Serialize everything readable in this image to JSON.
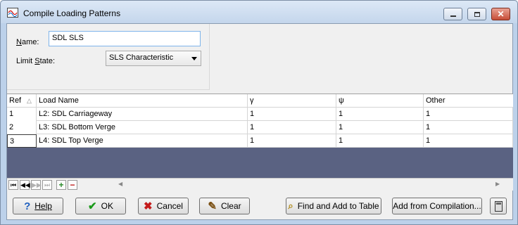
{
  "window": {
    "title": "Compile Loading Patterns",
    "icon": "chart-icon",
    "controls": [
      "minimize-icon",
      "maximize-icon",
      "close-icon"
    ]
  },
  "form": {
    "name_label": "Name:",
    "name_value": "SDL SLS",
    "limit_state_label": "Limit State:",
    "limit_state_value": "SLS Characteristic"
  },
  "grid": {
    "columns": [
      "Ref",
      "Load Name",
      "γ",
      "ψ",
      "Other"
    ],
    "rows": [
      [
        "1",
        "L2: SDL Carriageway",
        "1",
        "1",
        "1"
      ],
      [
        "2",
        "L3: SDL Bottom Verge",
        "1",
        "1",
        "1"
      ],
      [
        "3",
        "L4: SDL Top Verge",
        "1",
        "1",
        "1"
      ]
    ],
    "sort_icon": "sort-ascending-icon"
  },
  "navigator": {
    "buttons": [
      "first-record-icon",
      "prior-record-icon",
      "next-record-icon",
      "last-record-icon",
      "add-record-icon",
      "delete-record-icon"
    ]
  },
  "buttons": {
    "help": "Help",
    "ok": "OK",
    "cancel": "Cancel",
    "clear": "Clear",
    "find_add": "Find and Add to Table",
    "add_compilation": "Add from Compilation...",
    "calculator_icon": "calculator-icon"
  }
}
